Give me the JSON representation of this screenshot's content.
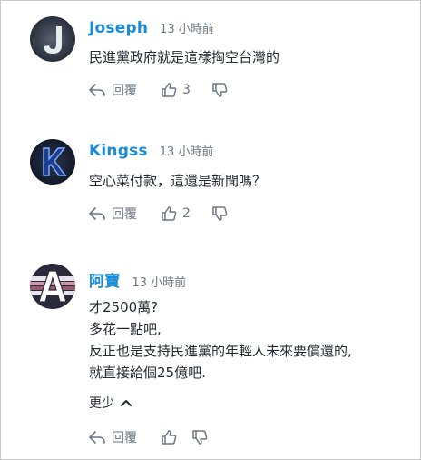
{
  "comments": [
    {
      "username": "Joseph",
      "time": "13 小時前",
      "avatar_letter": "J",
      "body": "民進黨政府就是這樣掏空台灣的",
      "reply_label": "回覆",
      "like_count": "3"
    },
    {
      "username": "Kingss",
      "time": "13 小時前",
      "avatar_letter": "K",
      "body": "空心菜付款，這還是新聞嗎？",
      "reply_label": "回覆",
      "like_count": "2"
    },
    {
      "username": "阿寶",
      "time": "13 小時前",
      "avatar_letter": "A",
      "body": "才2500萬?\n多花一點吧,\n反正也是支持民進黨的年輕人未來要償還的,\n就直接給個25億吧.",
      "show_less_label": "更少",
      "reply_label": "回覆",
      "like_count": ""
    }
  ],
  "icons": {
    "reply": "reply-arrow-icon",
    "like": "thumbs-up-icon",
    "dislike": "thumbs-down-icon",
    "collapse": "chevron-up-icon"
  },
  "colors": {
    "username": "#1a8cd8",
    "meta": "#6e7780",
    "text": "#232a31"
  }
}
